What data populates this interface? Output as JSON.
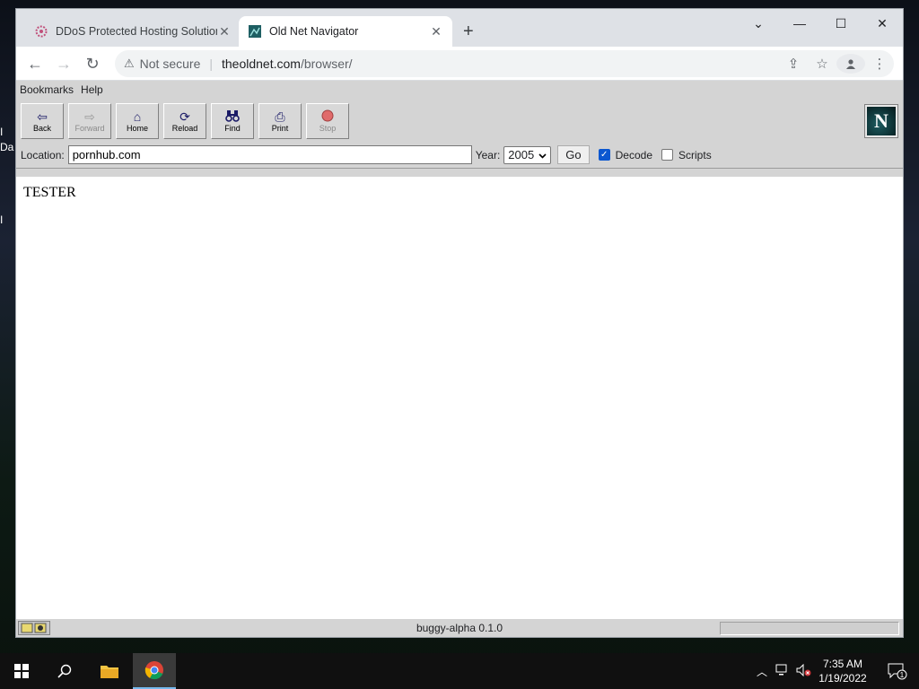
{
  "desktop": {
    "frag_a": "I",
    "frag_b": "Da",
    "frag_c": "I"
  },
  "chrome": {
    "tabs": [
      {
        "title": "DDoS Protected Hosting Solution",
        "icon": "ddos-favicon"
      },
      {
        "title": "Old Net Navigator",
        "icon": "oldnet-favicon"
      }
    ],
    "new_tab": "+",
    "window_controls": {
      "dropdown": "⌄",
      "minimize": "—",
      "maximize": "☐",
      "close": "✕"
    },
    "nav": {
      "back": "←",
      "forward": "→",
      "reload": "↻"
    },
    "address": {
      "warning": "⚠",
      "security": "Not secure",
      "host": "theoldnet.com",
      "path": "/browser/"
    }
  },
  "navigator": {
    "menu": [
      "Bookmarks",
      "Help"
    ],
    "buttons": [
      {
        "label": "Back",
        "icon": "⇦",
        "enabled": true
      },
      {
        "label": "Forward",
        "icon": "⇨",
        "enabled": false
      },
      {
        "label": "Home",
        "icon": "⌂",
        "enabled": true
      },
      {
        "label": "Reload",
        "icon": "⟳",
        "enabled": true
      },
      {
        "label": "Find",
        "icon": "🔭",
        "enabled": true
      },
      {
        "label": "Print",
        "icon": "⎙",
        "enabled": true
      },
      {
        "label": "Stop",
        "icon": "●",
        "enabled": false
      }
    ],
    "logo_letter": "N",
    "location_label": "Location:",
    "location_value": "pornhub.com",
    "year_label": "Year:",
    "year_value": "2005",
    "go_label": "Go",
    "decode_label": "Decode",
    "decode_checked": true,
    "scripts_label": "Scripts",
    "scripts_checked": false,
    "content_text": "TESTER",
    "status_text": "buggy-alpha 0.1.0"
  },
  "taskbar": {
    "time": "7:35 AM",
    "date": "1/19/2022",
    "notification_count": "1"
  }
}
